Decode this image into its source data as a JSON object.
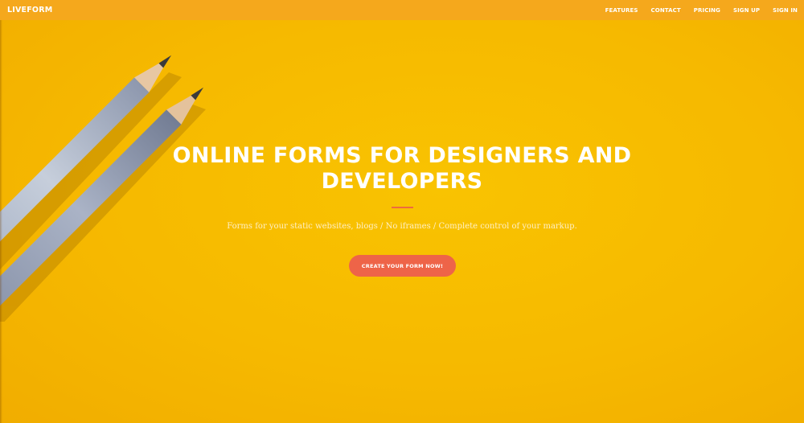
{
  "brand": {
    "name": "LIVEFORM"
  },
  "nav": {
    "items": [
      {
        "label": "FEATURES"
      },
      {
        "label": "CONTACT"
      },
      {
        "label": "PRICING"
      },
      {
        "label": "SIGN UP"
      },
      {
        "label": "SIGN IN"
      }
    ]
  },
  "hero": {
    "title": "ONLINE FORMS FOR DESIGNERS AND DEVELOPERS",
    "subtitle": "Forms for your static websites, blogs / No iframes / Complete control of your markup.",
    "cta_label": "CREATE YOUR FORM NOW!"
  },
  "colors": {
    "background": "#f6b900",
    "navbar": "#f5a81c",
    "accent": "#ee6448",
    "text": "#ffffff"
  }
}
